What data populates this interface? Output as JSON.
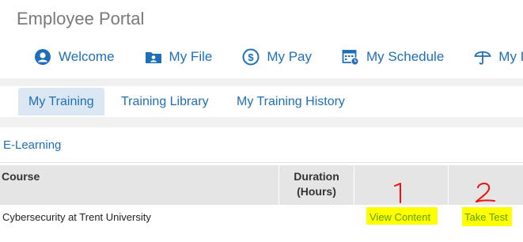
{
  "portal": {
    "title": "Employee Portal"
  },
  "nav": {
    "items": [
      {
        "label": "Welcome",
        "icon": "user-icon"
      },
      {
        "label": "My File",
        "icon": "folder-user-icon"
      },
      {
        "label": "My Pay",
        "icon": "dollar-icon"
      },
      {
        "label": "My Schedule",
        "icon": "calendar-icon"
      },
      {
        "label": "My I",
        "icon": "umbrella-icon"
      }
    ]
  },
  "subtabs": {
    "items": [
      {
        "label": "My Training",
        "active": true
      },
      {
        "label": "Training Library",
        "active": false
      },
      {
        "label": "My Training History",
        "active": false
      }
    ]
  },
  "elearning": {
    "title": "E-Learning",
    "columns": {
      "course": "Course",
      "duration_line1": "Duration",
      "duration_line2": "(Hours)"
    },
    "rows": [
      {
        "course": "Cybersecurity at Trent University",
        "view": "View Content",
        "test": "Take Test"
      }
    ]
  },
  "annotations": {
    "one": "1",
    "two": "2"
  },
  "colors": {
    "link_blue": "#1f6fb8",
    "link_green": "#5aa000",
    "highlight": "#ffff00",
    "annotation_red": "#ee1111"
  }
}
